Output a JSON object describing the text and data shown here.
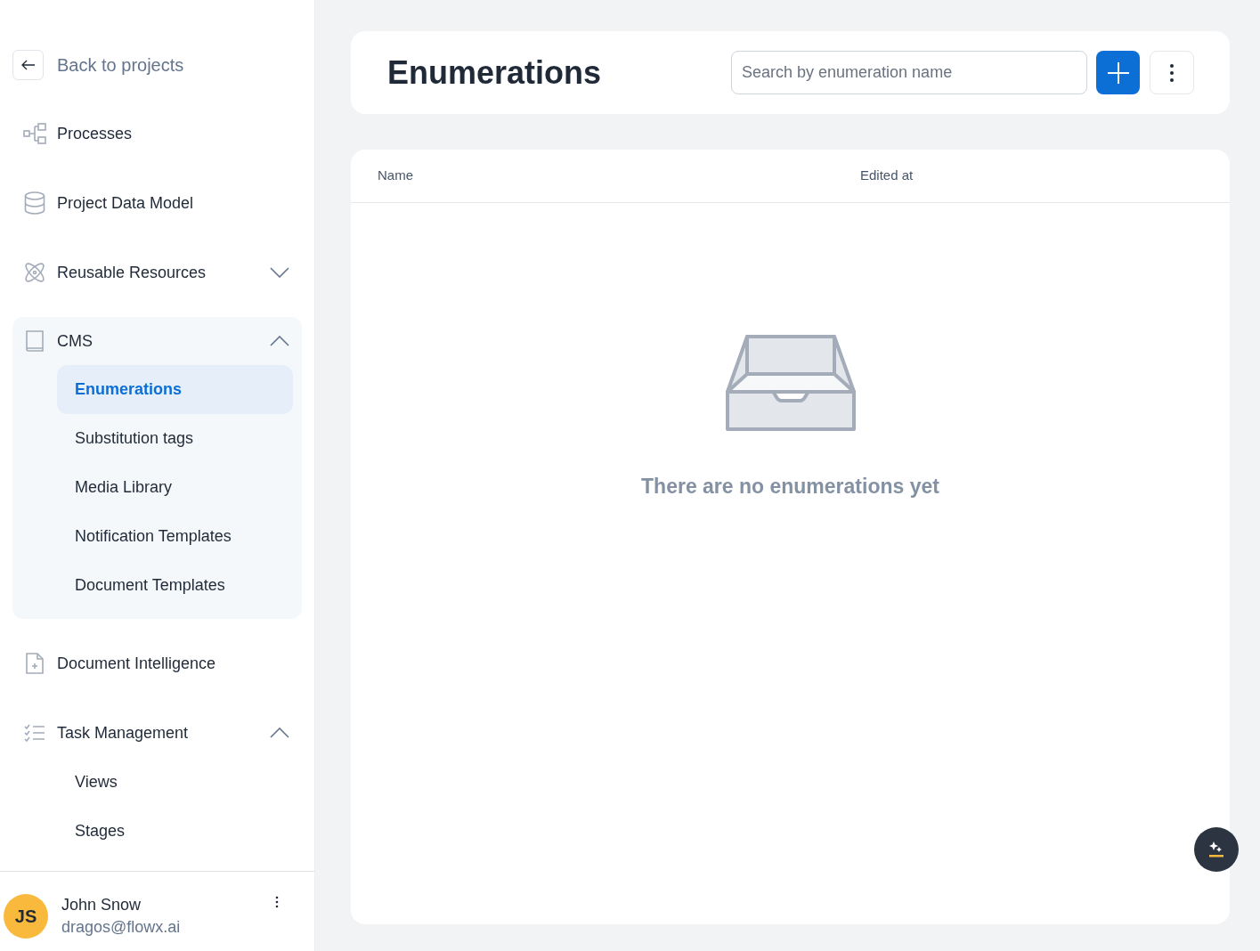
{
  "sidebar": {
    "back_link": "Back to projects",
    "items": [
      {
        "label": "Processes",
        "kind": "processes"
      },
      {
        "label": "Project Data Model",
        "kind": "database"
      },
      {
        "label": "Reusable Resources",
        "kind": "resources",
        "expanded": false
      },
      {
        "label": "CMS",
        "kind": "book",
        "expanded": true,
        "children": [
          {
            "label": "Enumerations",
            "selected": true
          },
          {
            "label": "Substitution tags",
            "selected": false
          },
          {
            "label": "Media Library",
            "selected": false
          },
          {
            "label": "Notification Templates",
            "selected": false
          },
          {
            "label": "Document Templates",
            "selected": false
          }
        ]
      },
      {
        "label": "Document Intelligence",
        "kind": "document"
      },
      {
        "label": "Task Management",
        "kind": "tasks",
        "expanded": true,
        "children": [
          {
            "label": "Views",
            "selected": false
          },
          {
            "label": "Stages",
            "selected": false
          }
        ]
      }
    ],
    "user": {
      "initials": "JS",
      "name": "John Snow",
      "email": "dragos@flowx.ai"
    }
  },
  "header": {
    "title": "Enumerations",
    "search": {
      "placeholder": "Search by enumeration name"
    }
  },
  "table": {
    "columns": [
      "Name",
      "Edited at"
    ],
    "empty_message": "There are no enumerations yet"
  }
}
